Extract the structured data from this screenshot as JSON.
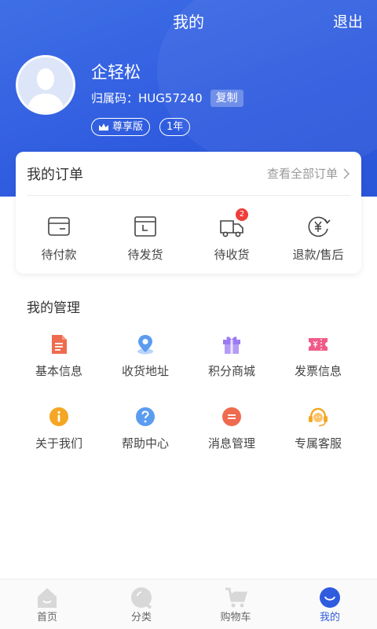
{
  "header": {
    "title": "我的",
    "logout_label": "退出"
  },
  "profile": {
    "name": "企轻松",
    "ref_label": "归属码：",
    "ref_code": "HUG57240",
    "copy_label": "复制",
    "tier_badge": "尊享版",
    "duration_badge": "1年"
  },
  "orders": {
    "title": "我的订单",
    "view_all": "查看全部订单",
    "items": [
      {
        "label": "待付款",
        "icon": "wallet-icon"
      },
      {
        "label": "待发货",
        "icon": "box-icon"
      },
      {
        "label": "待收货",
        "icon": "truck-icon",
        "badge": "2"
      },
      {
        "label": "退款/售后",
        "icon": "yen-refund-icon"
      }
    ]
  },
  "management": {
    "title": "我的管理",
    "items": [
      {
        "label": "基本信息",
        "icon": "document-icon",
        "color": "#ef6b4f"
      },
      {
        "label": "收货地址",
        "icon": "location-icon",
        "color": "#5b9cf0"
      },
      {
        "label": "积分商城",
        "icon": "gift-icon",
        "color": "#9b7cf0"
      },
      {
        "label": "发票信息",
        "icon": "ticket-icon",
        "color": "#f05b8a"
      },
      {
        "label": "关于我们",
        "icon": "info-icon",
        "color": "#f5a623"
      },
      {
        "label": "帮助中心",
        "icon": "help-icon",
        "color": "#5b9cf0"
      },
      {
        "label": "消息管理",
        "icon": "message-icon",
        "color": "#ef6b4f"
      },
      {
        "label": "专属客服",
        "icon": "headset-icon",
        "color": "#f5a623"
      }
    ]
  },
  "tabbar": {
    "items": [
      {
        "label": "首页",
        "icon": "home-icon"
      },
      {
        "label": "分类",
        "icon": "category-icon"
      },
      {
        "label": "购物车",
        "icon": "cart-icon"
      },
      {
        "label": "我的",
        "icon": "profile-icon",
        "active": true
      }
    ]
  },
  "colors": {
    "primary": "#2f5bdf",
    "badge_red": "#ee3d3a"
  }
}
